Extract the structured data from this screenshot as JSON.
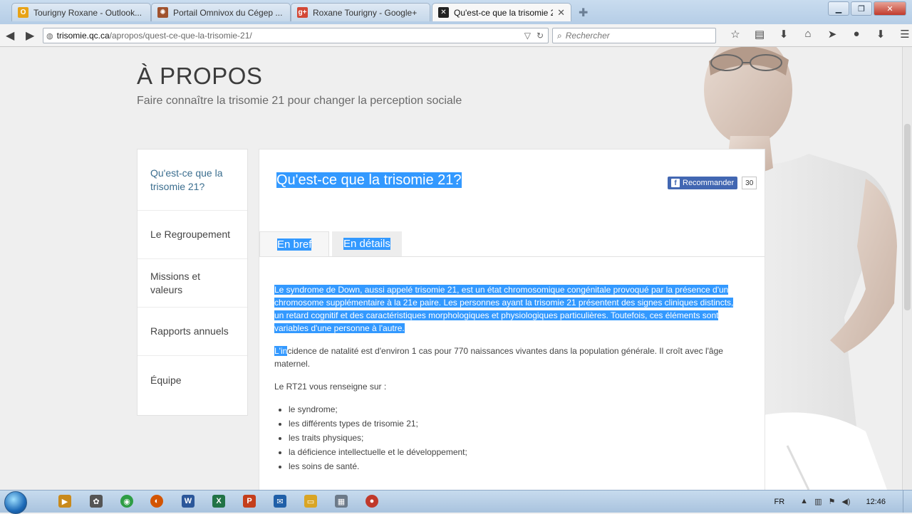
{
  "browser": {
    "tabs": [
      {
        "title": "Tourigny Roxane - Outlook...",
        "icon": "outlook-icon",
        "color": "#e8a317",
        "glyph": "O"
      },
      {
        "title": "Portail Omnivox du Cégep ...",
        "icon": "omnivox-icon",
        "color": "#a0522d",
        "glyph": "✺"
      },
      {
        "title": "Roxane Tourigny - Google+",
        "icon": "google-plus-icon",
        "color": "#d34836",
        "glyph": "g+"
      },
      {
        "title": "Qu'est-ce que la trisomie 2...",
        "icon": "trisomie-icon",
        "color": "#222222",
        "glyph": "✕"
      }
    ],
    "url_host": "trisomie.qc.ca",
    "url_path": "/apropos/quest-ce-que-la-trisomie-21/",
    "search_placeholder": "Rechercher"
  },
  "page": {
    "heading": "À PROPOS",
    "subtitle": "Faire connaître la trisomie 21 pour changer la perception sociale",
    "sidenav": [
      "Qu'est-ce que la trisomie 21?",
      "Le Regroupement",
      "Missions et valeurs",
      "Rapports annuels",
      "Équipe"
    ],
    "article": {
      "title": "Qu'est-ce que la trisomie 21?",
      "fb_label": "Recommander",
      "fb_count": "30",
      "tabs": [
        "En bref",
        "En détails"
      ],
      "para1": "Le syndrome de Down, aussi appelé trisomie 21, est un état chromosomique congénitale provoqué par la présence d'un chromosome supplémentaire à la 21e paire. Les personnes ayant la trisomie 21 présentent des signes cliniques distincts, un retard cognitif et des caractéristiques morphologiques et physiologiques particulières. Toutefois, ces éléments sont variables d'une personne à l'autre.",
      "para2_sel": "L'in",
      "para2_rest": "cidence de natalité est d'environ 1 cas pour 770 naissances vivantes dans la population générale. Il croît avec l'âge maternel.",
      "para3": "Le RT21 vous renseigne sur :",
      "list": [
        "le syndrome;",
        "les différents types de trisomie 21;",
        "les traits physiques;",
        "la déficience intellectuelle et le développement;",
        "les soins de santé."
      ]
    }
  },
  "taskbar": {
    "apps": [
      {
        "icon": "media-player-icon",
        "glyph": "▶",
        "color": "#c98a1b"
      },
      {
        "icon": "paint-icon",
        "glyph": "✿",
        "color": "#555555"
      },
      {
        "icon": "chrome-icon",
        "glyph": "◉",
        "color": "#2e9d44"
      },
      {
        "icon": "firefox-icon",
        "glyph": "◐",
        "color": "#d35400"
      },
      {
        "icon": "word-icon",
        "glyph": "W",
        "color": "#2b579a"
      },
      {
        "icon": "excel-icon",
        "glyph": "X",
        "color": "#217346"
      },
      {
        "icon": "powerpoint-icon",
        "glyph": "P",
        "color": "#c43e1c"
      },
      {
        "icon": "outlook-taskbar-icon",
        "glyph": "✉",
        "color": "#1f5fa8"
      },
      {
        "icon": "explorer-icon",
        "glyph": "▭",
        "color": "#d9a524"
      },
      {
        "icon": "calculator-icon",
        "glyph": "▦",
        "color": "#6c7a89"
      },
      {
        "icon": "recorder-icon",
        "glyph": "●",
        "color": "#c0392b"
      }
    ],
    "lang": "FR",
    "clock": "12:46"
  }
}
